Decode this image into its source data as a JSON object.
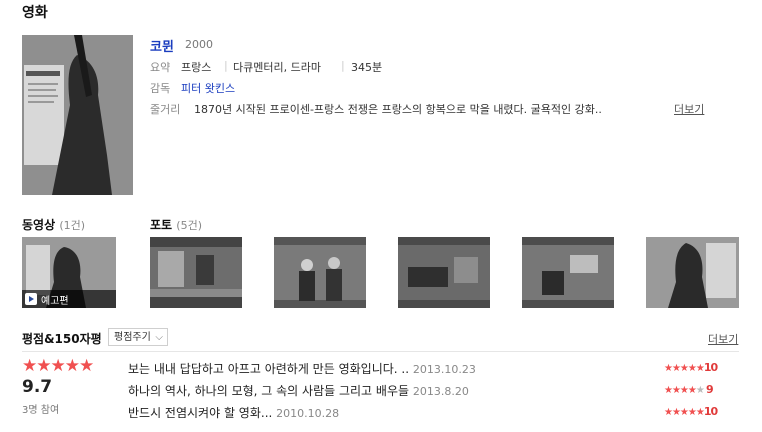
{
  "section_title": "영화",
  "movie": {
    "title": "코뮌",
    "year": "2000",
    "summary_label": "요약",
    "country": "프랑스",
    "genre": "다큐멘터리, 드라마",
    "runtime": "345분",
    "director_label": "감독",
    "director": "피터 왓킨스",
    "plot_label": "줄거리",
    "plot": "1870년 시작된 프로이센-프랑스 전쟁은 프랑스의 항복으로 막을 내렸다. 굴욕적인 강화..",
    "more": "더보기"
  },
  "videos": {
    "title": "동영상",
    "count": "(1건)",
    "badge": "예고편"
  },
  "photos": {
    "title": "포토",
    "count": "(5건)"
  },
  "reviews": {
    "title": "평점&150자평",
    "sort_label": "평점주기",
    "more": "더보기",
    "average": "9.7",
    "participants": "3명 참여",
    "items": [
      {
        "text": "보는 내내 답답하고 아프고 아련하게 만든 영화입니다. ..",
        "date": "2013.10.23",
        "score": "10",
        "stars": 5
      },
      {
        "text": "하나의 역사, 하나의 모형, 그 속의 사람들 그리고 배우들",
        "date": "2013.8.20",
        "score": "9",
        "stars": 4.5
      },
      {
        "text": "반드시 전염시켜야 할 영화...",
        "date": "2010.10.28",
        "score": "10",
        "stars": 5
      }
    ]
  },
  "colors": {
    "accent": "#1a3dbf",
    "star": "#f05050"
  }
}
